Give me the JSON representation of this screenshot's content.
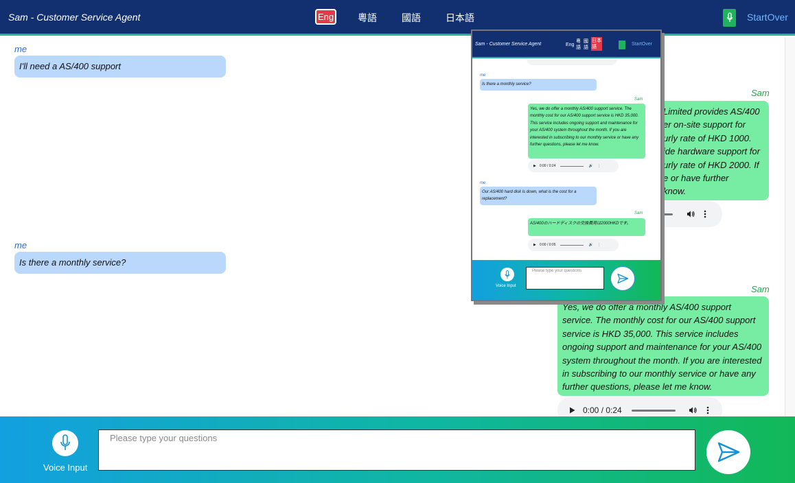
{
  "header": {
    "title": "Sam - Customer Service Agent",
    "languages": [
      "Eng",
      "粵語",
      "國語",
      "日本語"
    ],
    "active_language": "Eng",
    "mic_icon": "microphone-icon",
    "startover_label": "StartOver"
  },
  "chat": {
    "messages": [
      {
        "sender": "me",
        "text": "I'll need a AS/400 support"
      },
      {
        "sender": "Sam",
        "text_lines": [
          "Limited provides AS/400",
          "er on-site support for",
          "urly rate of HKD 1000.",
          "ide hardware support for",
          "urly rate of HKD 2000. If",
          "e or have further",
          "know."
        ]
      },
      {
        "sender": "me",
        "text": "Is there a monthly service?"
      },
      {
        "sender": "Sam",
        "text": "Yes, we do offer a monthly AS/400 support service. The monthly cost for our AS/400 support service is HKD 35,000. This service includes ongoing support and maintenance for your AS/400 system throughout the month. If you are interested in subscribing to our monthly service or have any further questions, please let me know.",
        "audio_time": "0:00 / 0:24"
      }
    ]
  },
  "input": {
    "voice_label": "Voice Input",
    "placeholder": "Please type your questions"
  },
  "thumbnail": {
    "title": "Sam - Customer Service Agent",
    "lang_eng": "Eng",
    "lang_yue": [
      "粵",
      "語"
    ],
    "lang_man": [
      "國",
      "語"
    ],
    "lang_ja": [
      "日本",
      "語"
    ],
    "startover_label": "StartOver",
    "messages": [
      {
        "sender": "me",
        "text": "Is there a monthly service?"
      },
      {
        "sender": "Sam",
        "text": "Yes, we do offer a monthly AS/400 support service. The monthly cost for our AS/400 support service is HKD 35,000. This service includes ongoing support and maintenance for your AS/400 system throughout the month. If you are interested in subscribing to our monthly service or have any further questions, please let me know.",
        "audio_time": "0:00 / 0:24"
      },
      {
        "sender": "me",
        "text": "Our AS/400 hard disk is down, what is the cost for a replacement?"
      },
      {
        "sender": "Sam",
        "text": "AS/400のハードディスクの交換費用は2000HKDです。",
        "audio_time": "0:00 / 0:05"
      }
    ],
    "voice_label": "Voice Input",
    "placeholder": "Please type your questions"
  }
}
